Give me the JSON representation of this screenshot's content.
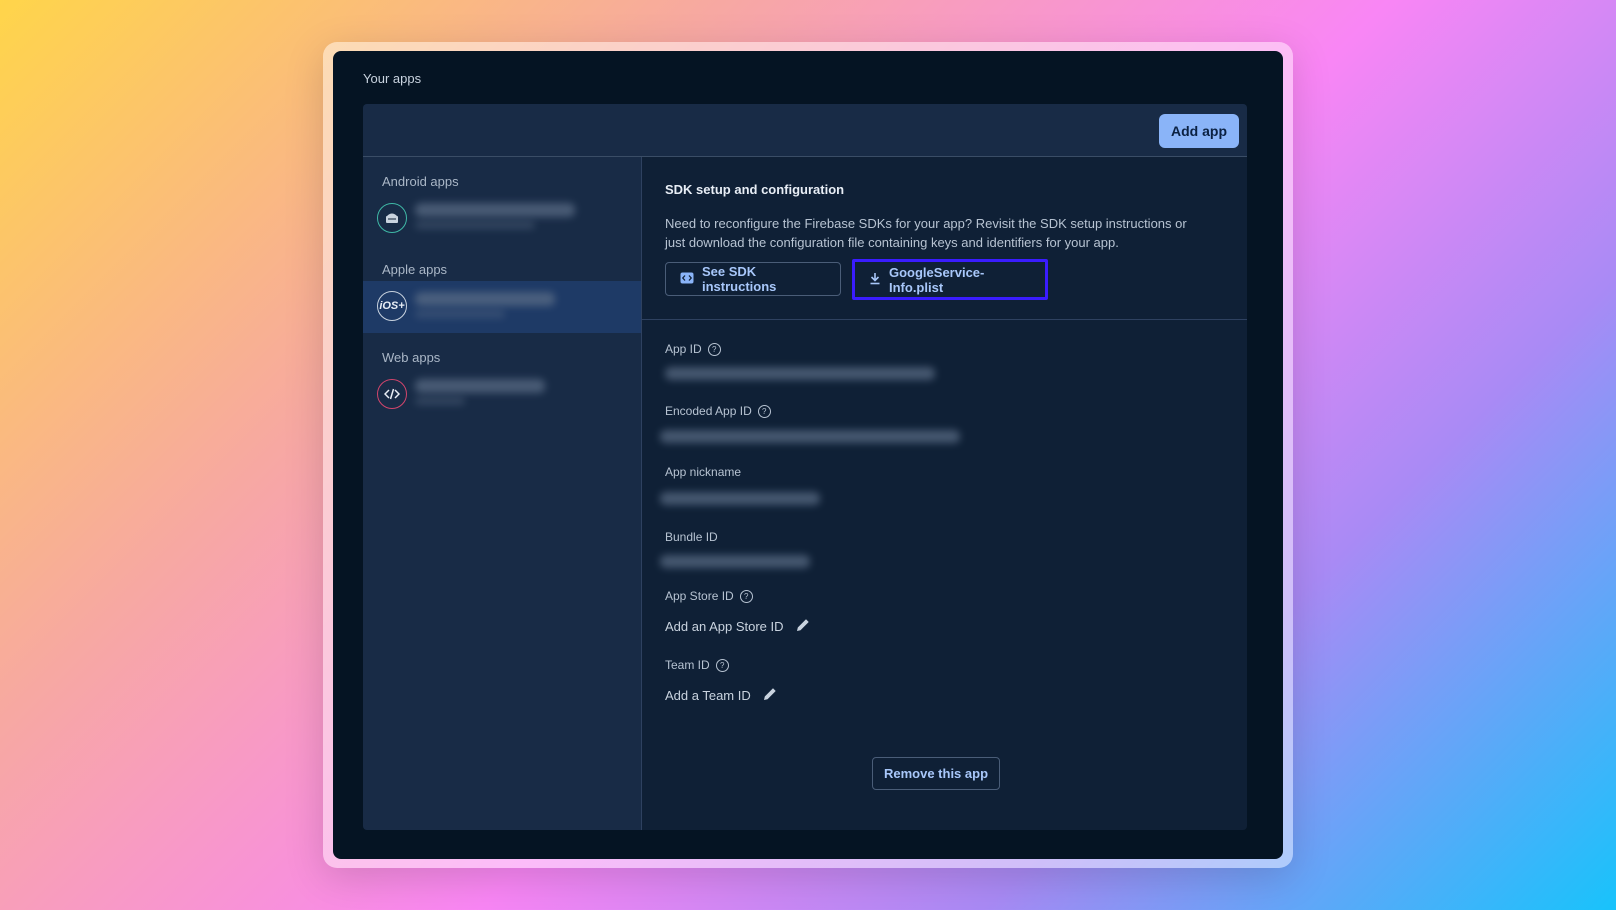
{
  "window": {
    "section_title": "Your apps"
  },
  "header": {
    "add_app_label": "Add app"
  },
  "sidebar": {
    "groups": [
      {
        "label": "Android apps",
        "icon": "android-icon"
      },
      {
        "label": "Apple apps",
        "icon": "ios-icon",
        "icon_text": "iOS+"
      },
      {
        "label": "Web apps",
        "icon": "code-icon"
      }
    ]
  },
  "sdk": {
    "title": "SDK setup and configuration",
    "description": "Need to reconfigure the Firebase SDKs for your app? Revisit the SDK setup instructions or just download the configuration file containing keys and identifiers for your app.",
    "see_instructions_label": "See SDK instructions",
    "download_label": "GoogleService-Info.plist"
  },
  "fields": {
    "app_id": "App ID",
    "encoded_app_id": "Encoded App ID",
    "app_nickname": "App nickname",
    "bundle_id": "Bundle ID",
    "app_store_id": "App Store ID",
    "app_store_action": "Add an App Store ID",
    "team_id": "Team ID",
    "team_action": "Add a Team ID"
  },
  "footer": {
    "remove_label": "Remove this app"
  },
  "colors": {
    "accent": "#8ab4f8",
    "highlight_border": "#3a1cff",
    "background": "#051423"
  }
}
